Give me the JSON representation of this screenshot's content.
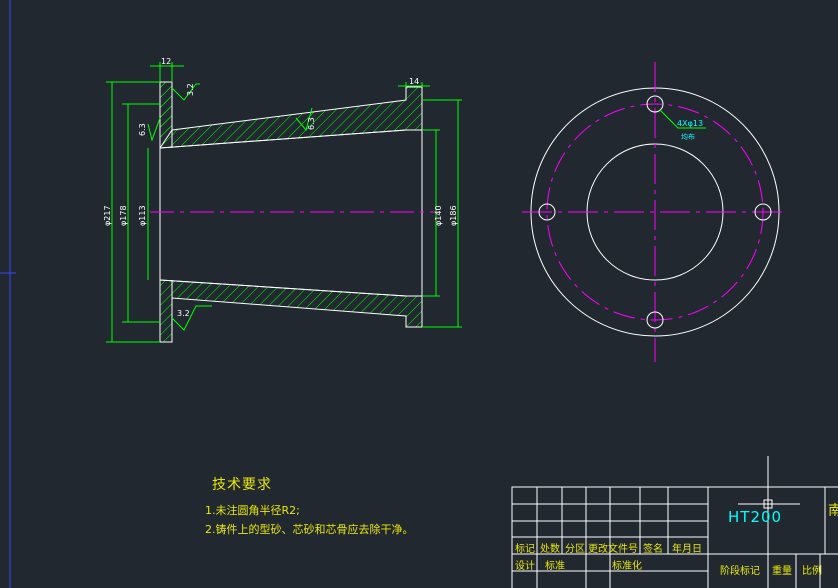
{
  "drawing": {
    "dimensions": {
      "top_width": "12",
      "right_width": "14",
      "roughness_top": "3.2",
      "roughness_bottom": "3.2",
      "roughness_left": "6.3",
      "roughness_taper": "6.3",
      "dia_217": "φ217",
      "dia_178": "φ178",
      "dia_113": "φ113",
      "dia_140": "φ140",
      "dia_186": "φ186"
    },
    "hole_note": "4Xφ13",
    "hole_note_sub": "均布"
  },
  "technical_requirements": {
    "title": "技术要求",
    "items": [
      "1.未注圆角半径R2;",
      "2.铸件上的型砂、芯砂和芯骨应去除干净。"
    ]
  },
  "title_block": {
    "material": "HT200",
    "row1": [
      "标记",
      "处数",
      "分区",
      "更改文件号",
      "签名",
      "年月日"
    ],
    "row2": [
      "设计",
      "标准",
      "",
      "标准化"
    ],
    "stage_mark": "阶段标记",
    "weight": "重量",
    "scale": "比例",
    "right_edge_char": "南"
  },
  "colors": {
    "background": "#212830",
    "outline": "#ffffff",
    "hatch": "#00ff00",
    "centerline": "#ff00ff",
    "dimension": "#00ff00",
    "text": "#e8e800",
    "accent": "#00ffff"
  }
}
